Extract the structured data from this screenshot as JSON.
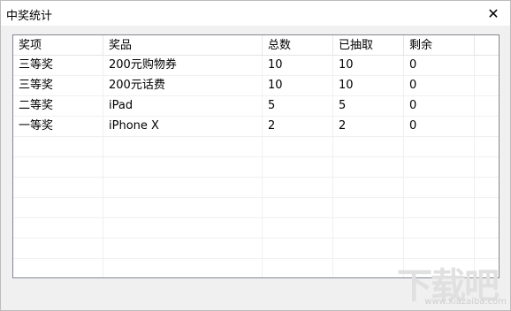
{
  "window": {
    "title": "中奖统计",
    "close_glyph": "✕"
  },
  "table": {
    "headers": [
      "奖项",
      "奖品",
      "总数",
      "已抽取",
      "剩余"
    ],
    "rows": [
      [
        "三等奖",
        "200元购物券",
        "10",
        "10",
        "0"
      ],
      [
        "三等奖",
        "200元话费",
        "10",
        "10",
        "0"
      ],
      [
        "二等奖",
        "iPad",
        "5",
        "5",
        "0"
      ],
      [
        "一等奖",
        "iPhone X",
        "2",
        "2",
        "0"
      ]
    ]
  },
  "watermark": {
    "text": "下载吧",
    "url": "www.xiazaiba.com"
  }
}
